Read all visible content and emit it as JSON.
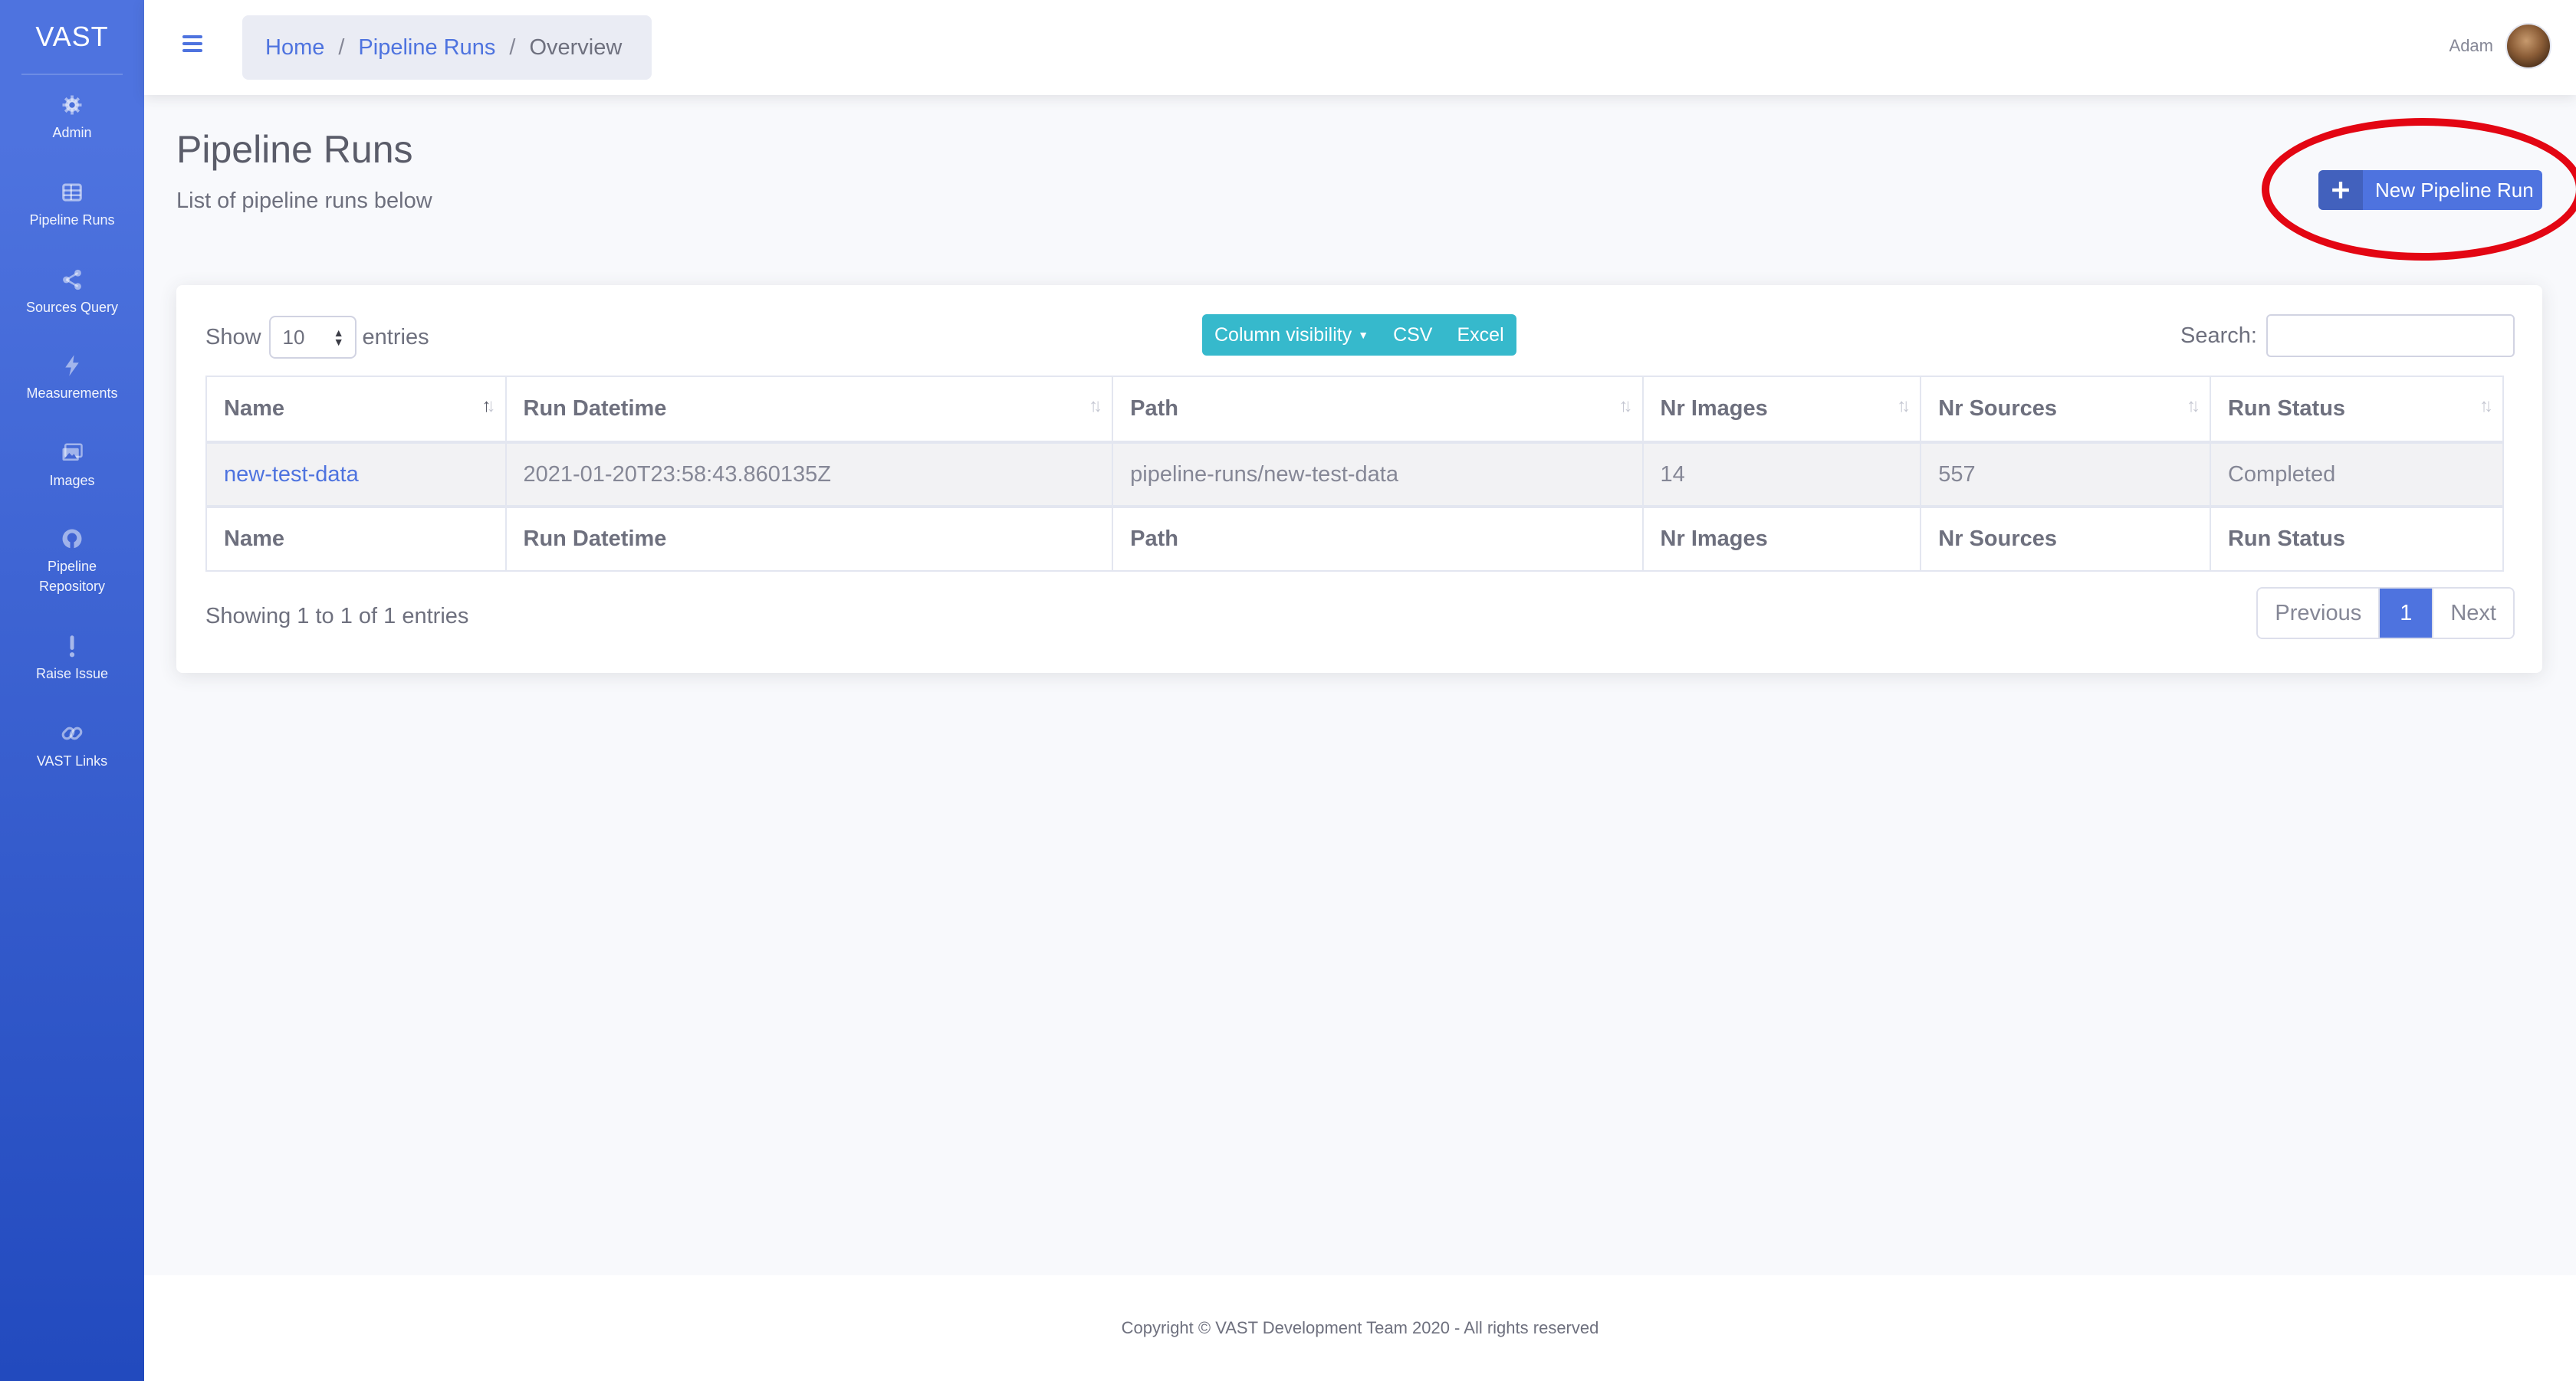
{
  "sidebar": {
    "brand": "VAST",
    "items": [
      {
        "label": "Admin",
        "icon": "gear-icon"
      },
      {
        "label": "Pipeline Runs",
        "icon": "table-icon"
      },
      {
        "label": "Sources Query",
        "icon": "share-icon"
      },
      {
        "label": "Measurements",
        "icon": "bolt-icon"
      },
      {
        "label": "Images",
        "icon": "images-icon"
      },
      {
        "label": "Pipeline Repository",
        "icon": "github-icon"
      },
      {
        "label": "Raise Issue",
        "icon": "exclamation-icon"
      },
      {
        "label": "VAST Links",
        "icon": "link-icon"
      }
    ]
  },
  "topbar": {
    "breadcrumb": [
      "Home",
      "Pipeline Runs",
      "Overview"
    ],
    "user_name": "Adam"
  },
  "header": {
    "title": "Pipeline Runs",
    "subtitle": "List of pipeline runs below",
    "new_run_label": "New Pipeline Run"
  },
  "table_controls": {
    "show_label": "Show",
    "page_length": "10",
    "entries_label": "entries",
    "buttons": [
      "Column visibility",
      "CSV",
      "Excel"
    ],
    "search_label": "Search:",
    "search_value": ""
  },
  "table": {
    "columns": [
      "Name",
      "Run Datetime",
      "Path",
      "Nr Images",
      "Nr Sources",
      "Run Status"
    ],
    "sorted_column": "Name",
    "sort_direction": "ascending",
    "rows": [
      {
        "name": "new-test-data",
        "run_datetime": "2021-01-20T23:58:43.860135Z",
        "path": "pipeline-runs/new-test-data",
        "nr_images": "14",
        "nr_sources": "557",
        "run_status": "Completed"
      }
    ]
  },
  "table_info": "Showing 1 to 1 of 1 entries",
  "pagination": {
    "previous": "Previous",
    "current": "1",
    "next": "Next"
  },
  "footer": {
    "copyright": "Copyright © VAST Development Team 2020 - All rights reserved"
  },
  "colors": {
    "primary": "#4e73df",
    "sidebar_gradient_end": "#224abe",
    "teal": "#36b9cc",
    "annotation_ring": "#e30613"
  }
}
